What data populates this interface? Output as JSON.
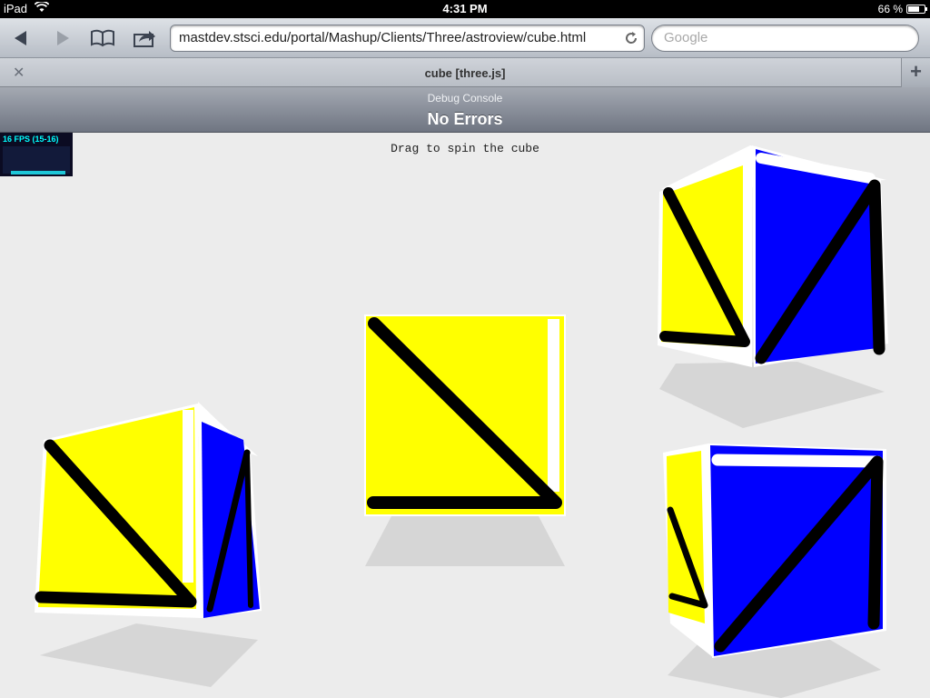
{
  "status_bar": {
    "device": "iPad",
    "time": "4:31 PM",
    "battery": "66 %"
  },
  "browser": {
    "url": "mastdev.stsci.edu/portal/Mashup/Clients/Three/astroview/cube.html",
    "search_placeholder": "Google",
    "tab_title": "cube [three.js]"
  },
  "debug_console": {
    "title": "Debug Console",
    "status": "No Errors"
  },
  "page": {
    "fps": "16 FPS (15-16)",
    "hint": "Drag to spin the cube"
  },
  "colors": {
    "face_yellow": "#ffff00",
    "face_blue": "#0000ff",
    "stroke": "#000000",
    "shadow": "#d6d6d6"
  }
}
